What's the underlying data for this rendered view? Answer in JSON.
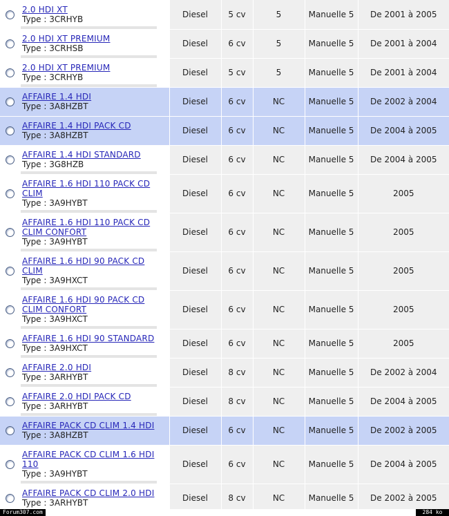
{
  "rows": [
    {
      "name": "2.0 HDI XT",
      "type": "Type : 3CRHYB",
      "fuel": "Diesel",
      "cv": "5 cv",
      "doors": "5",
      "gearbox": "Manuelle 5",
      "period": "De 2001 à 2005"
    },
    {
      "name": "2.0 HDI XT PREMIUM",
      "type": "Type : 3CRHSB",
      "fuel": "Diesel",
      "cv": "6 cv",
      "doors": "5",
      "gearbox": "Manuelle 5",
      "period": "De 2001 à 2004"
    },
    {
      "name": "2.0 HDI XT PREMIUM",
      "type": "Type : 3CRHYB",
      "fuel": "Diesel",
      "cv": "5 cv",
      "doors": "5",
      "gearbox": "Manuelle 5",
      "period": "De 2001 à 2004"
    },
    {
      "name": "AFFAIRE 1.4 HDI",
      "type": "Type : 3A8HZBT",
      "fuel": "Diesel",
      "cv": "6 cv",
      "doors": "NC",
      "gearbox": "Manuelle 5",
      "period": "De 2002 à 2004"
    },
    {
      "name": "AFFAIRE 1.4 HDI PACK CD",
      "type": "Type : 3A8HZBT",
      "fuel": "Diesel",
      "cv": "6 cv",
      "doors": "NC",
      "gearbox": "Manuelle 5",
      "period": "De 2004 à 2005"
    },
    {
      "name": "AFFAIRE 1.4 HDI STANDARD",
      "type": "Type : 3G8HZB",
      "fuel": "Diesel",
      "cv": "6 cv",
      "doors": "NC",
      "gearbox": "Manuelle 5",
      "period": "De 2004 à 2005"
    },
    {
      "name": "AFFAIRE 1.6 HDI 110 PACK CD CLIM",
      "type": "Type : 3A9HYBT",
      "fuel": "Diesel",
      "cv": "6 cv",
      "doors": "NC",
      "gearbox": "Manuelle 5",
      "period": "2005"
    },
    {
      "name": "AFFAIRE 1.6 HDI 110 PACK CD CLIM CONFORT",
      "type": "Type : 3A9HYBT",
      "fuel": "Diesel",
      "cv": "6 cv",
      "doors": "NC",
      "gearbox": "Manuelle 5",
      "period": "2005"
    },
    {
      "name": "AFFAIRE 1.6 HDI 90 PACK CD CLIM",
      "type": "Type : 3A9HXCT",
      "fuel": "Diesel",
      "cv": "6 cv",
      "doors": "NC",
      "gearbox": "Manuelle 5",
      "period": "2005"
    },
    {
      "name": "AFFAIRE 1.6 HDI 90 PACK CD CLIM CONFORT",
      "type": "Type : 3A9HXCT",
      "fuel": "Diesel",
      "cv": "6 cv",
      "doors": "NC",
      "gearbox": "Manuelle 5",
      "period": "2005"
    },
    {
      "name": "AFFAIRE 1.6 HDI 90 STANDARD",
      "type": "Type : 3A9HXCT",
      "fuel": "Diesel",
      "cv": "6 cv",
      "doors": "NC",
      "gearbox": "Manuelle 5",
      "period": "2005"
    },
    {
      "name": "AFFAIRE 2.0 HDI",
      "type": "Type : 3ARHYBT",
      "fuel": "Diesel",
      "cv": "8 cv",
      "doors": "NC",
      "gearbox": "Manuelle 5",
      "period": "De 2002 à 2004"
    },
    {
      "name": "AFFAIRE 2.0 HDI PACK CD",
      "type": "Type : 3ARHYBT",
      "fuel": "Diesel",
      "cv": "8 cv",
      "doors": "NC",
      "gearbox": "Manuelle 5",
      "period": "De 2004 à 2005"
    },
    {
      "name": "AFFAIRE PACK CD CLIM 1.4 HDI",
      "type": "Type : 3A8HZBT",
      "fuel": "Diesel",
      "cv": "6 cv",
      "doors": "NC",
      "gearbox": "Manuelle 5",
      "period": "De 2002 à 2005"
    },
    {
      "name": "AFFAIRE PACK CD CLIM 1.6 HDI 110",
      "type": "Type : 3A9HYBT",
      "fuel": "Diesel",
      "cv": "6 cv",
      "doors": "NC",
      "gearbox": "Manuelle 5",
      "period": "De 2004 à 2005"
    },
    {
      "name": "AFFAIRE PACK CD CLIM 2.0 HDI",
      "type": "Type : 3ARHYBT",
      "fuel": "Diesel",
      "cv": "8 cv",
      "doors": "NC",
      "gearbox": "Manuelle 5",
      "period": "De 2002 à 2005"
    }
  ],
  "footer": {
    "site": "Forum307.com",
    "size": "284 ko"
  },
  "colors": {
    "link": "#2626b8",
    "highlight": "#c6d3f6",
    "cell_bg": "#efefef"
  }
}
